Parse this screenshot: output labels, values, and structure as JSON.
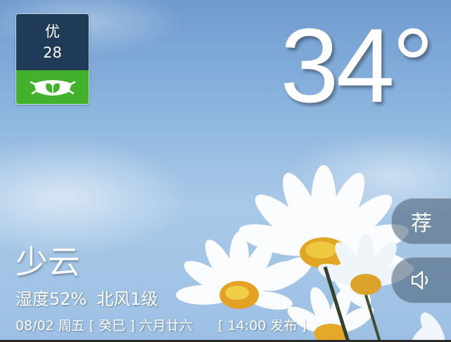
{
  "air_quality": {
    "level": "优",
    "value": "28",
    "icon": "leaf-mask-icon",
    "color": "#43b12b"
  },
  "temperature": "34°",
  "condition": "少云",
  "humidity": "湿度52%",
  "wind": "北风1级",
  "date_line": "08/02 周五 [ 癸巳 ] 六月廿六      [ 14:00 发布 ]",
  "buttons": {
    "recommend_label": "荐",
    "sound_icon": "speaker-icon"
  }
}
